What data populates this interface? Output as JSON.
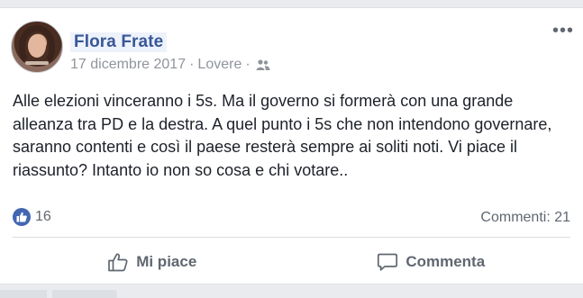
{
  "post": {
    "author": "Flora Frate",
    "date": "17 dicembre 2017",
    "separator": "·",
    "location": "Lovere",
    "separator2": "·",
    "privacy_icon": "friends-icon",
    "more_label": "•••",
    "text": "Alle elezioni vinceranno i 5s. Ma il governo si formerà con una grande alleanza tra PD e la destra. A quel punto i 5s che non intendono governare, saranno contenti e così il paese resterà sempre ai soliti noti. Vi piace il riassunto? Intanto io non so cosa e chi votare..",
    "likes": "16",
    "comments": "Commenti: 21"
  },
  "actions": {
    "like_label": "Mi piace",
    "comment_label": "Commenta"
  },
  "colors": {
    "author_link": "#385898",
    "like_blue": "#4267b2",
    "meta_gray": "#90949c"
  }
}
